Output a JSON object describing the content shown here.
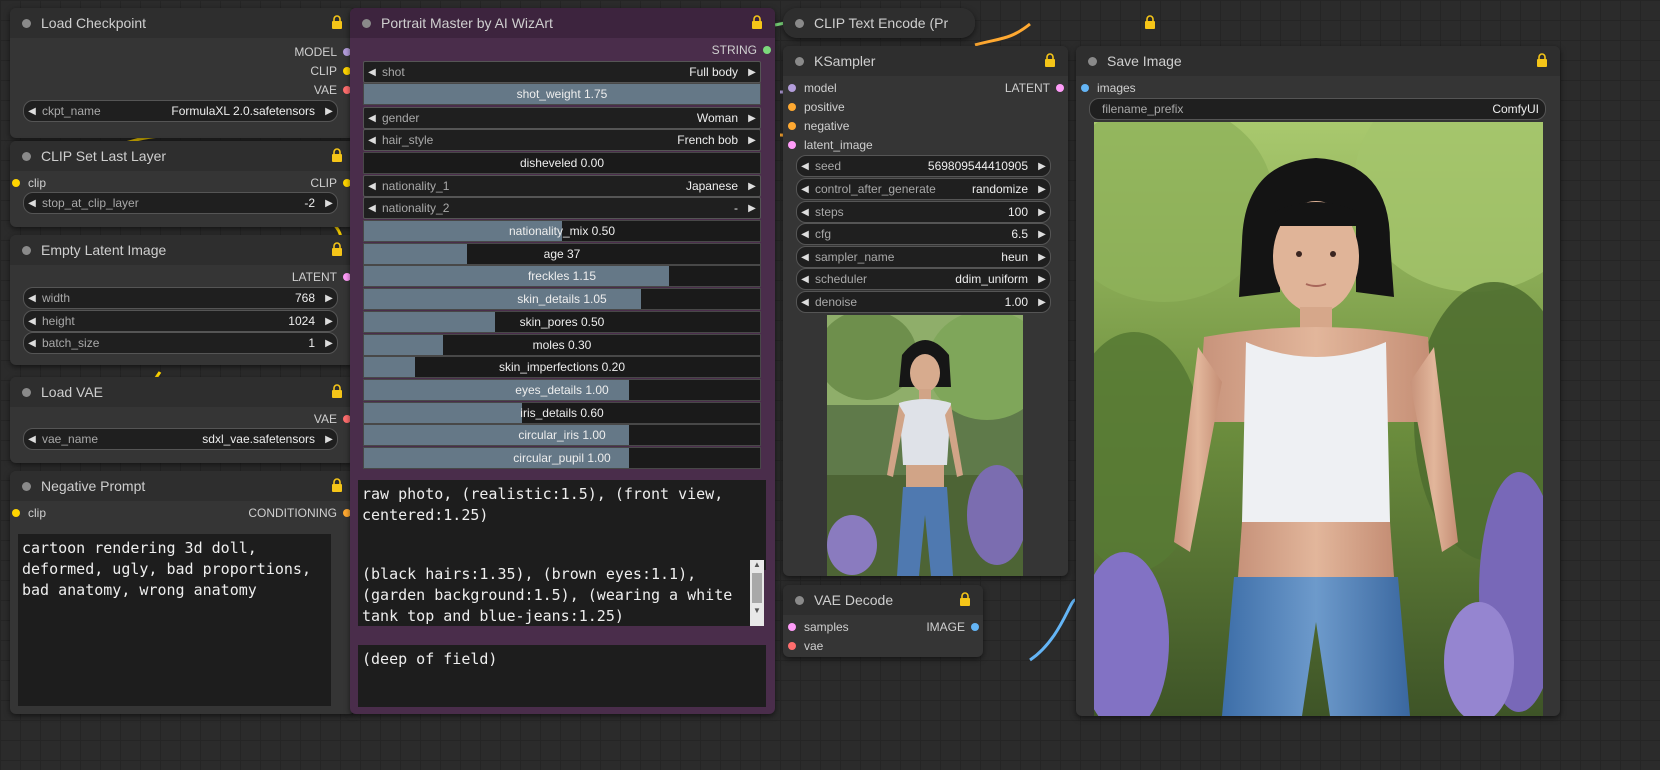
{
  "colors": {
    "model": "#b39ddb",
    "clip": "#ffd500",
    "vae": "#ff6e6e",
    "latent": "#ff9cf9",
    "conditioning": "#ffa931",
    "image": "#64b5f6",
    "string": "#7cd97c",
    "pm_bg": "#4a2d4b"
  },
  "load_checkpoint": {
    "title": "Load Checkpoint",
    "out_model": "MODEL",
    "out_clip": "CLIP",
    "out_vae": "VAE",
    "w_label": "ckpt_name",
    "w_value": "FormulaXL 2.0.safetensors"
  },
  "clip_set_last": {
    "title": "CLIP Set Last Layer",
    "in_clip": "clip",
    "out_clip": "CLIP",
    "w_label": "stop_at_clip_layer",
    "w_value": "-2"
  },
  "empty_latent": {
    "title": "Empty Latent Image",
    "out_latent": "LATENT",
    "widgets": [
      {
        "label": "width",
        "value": "768"
      },
      {
        "label": "height",
        "value": "1024"
      },
      {
        "label": "batch_size",
        "value": "1"
      }
    ]
  },
  "load_vae": {
    "title": "Load VAE",
    "out_vae": "VAE",
    "w_label": "vae_name",
    "w_value": "sdxl_vae.safetensors"
  },
  "negative_prompt": {
    "title": "Negative Prompt",
    "in_clip": "clip",
    "out_cond": "CONDITIONING",
    "text": "cartoon rendering 3d doll, deformed, ugly, bad proportions, bad anatomy, wrong anatomy"
  },
  "portrait_master": {
    "title": "Portrait Master by AI WizArt",
    "out_string": "STRING",
    "combos": [
      {
        "label": "shot",
        "value": "Full body"
      },
      {
        "label": "gender",
        "value": "Woman"
      },
      {
        "label": "hair_style",
        "value": "French bob"
      },
      {
        "label": "nationality_1",
        "value": "Japanese"
      },
      {
        "label": "nationality_2",
        "value": "-"
      }
    ],
    "shot_weight": {
      "text": "shot_weight  1.75",
      "level": 1.0
    },
    "disheveled": {
      "text": "disheveled  0.00",
      "level": 0.0
    },
    "sliders": [
      {
        "text": "nationality_mix  0.50",
        "level": 0.5
      },
      {
        "text": "age  37",
        "level": 0.26
      },
      {
        "text": "freckles  1.15",
        "level": 0.77
      },
      {
        "text": "skin_details  1.05",
        "level": 0.7
      },
      {
        "text": "skin_pores  0.50",
        "level": 0.33
      },
      {
        "text": "moles  0.30",
        "level": 0.2
      },
      {
        "text": "skin_imperfections  0.20",
        "level": 0.13
      },
      {
        "text": "eyes_details  1.00",
        "level": 0.67
      },
      {
        "text": "iris_details  0.60",
        "level": 0.4
      },
      {
        "text": "circular_iris  1.00",
        "level": 0.67
      },
      {
        "text": "circular_pupil  1.00",
        "level": 0.67
      }
    ],
    "prompt1": "raw photo, (realistic:1.5), (front view, centered:1.25)",
    "prompt2": "(black hairs:1.35), (brown eyes:1.1), (garden background:1.5), (wearing a white tank top and blue-jeans:1.25)",
    "prompt3": "(deep of field)"
  },
  "clip_text_encode": {
    "title": "CLIP Text Encode (Pr"
  },
  "ksampler": {
    "title": "KSampler",
    "in_model": "model",
    "in_positive": "positive",
    "in_negative": "negative",
    "in_latent": "latent_image",
    "out_latent": "LATENT",
    "widgets": [
      {
        "label": "seed",
        "value": "569809544410905"
      },
      {
        "label": "control_after_generate",
        "value": "randomize"
      },
      {
        "label": "steps",
        "value": "100"
      },
      {
        "label": "cfg",
        "value": "6.5"
      },
      {
        "label": "sampler_name",
        "value": "heun"
      },
      {
        "label": "scheduler",
        "value": "ddim_uniform"
      },
      {
        "label": "denoise",
        "value": "1.00"
      }
    ]
  },
  "vae_decode": {
    "title": "VAE Decode",
    "in_samples": "samples",
    "in_vae": "vae",
    "out_image": "IMAGE"
  },
  "save_image": {
    "title": "Save Image",
    "in_images": "images",
    "w_label": "filename_prefix",
    "w_value": "ComfyUI"
  }
}
